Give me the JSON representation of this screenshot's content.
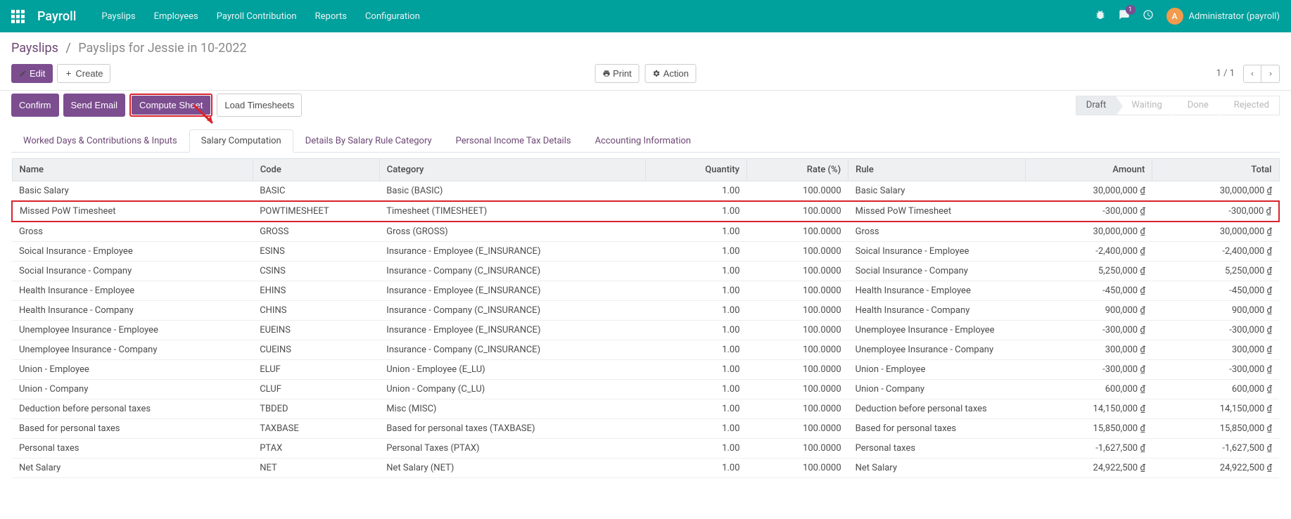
{
  "topbar": {
    "brand": "Payroll",
    "nav": [
      "Payslips",
      "Employees",
      "Payroll Contribution",
      "Reports",
      "Configuration"
    ],
    "chat_badge": "1",
    "user_initial": "A",
    "user_label": "Administrator (payroll)"
  },
  "breadcrumb": {
    "root": "Payslips",
    "current": "Payslips for Jessie in 10-2022"
  },
  "buttons": {
    "edit": "Edit",
    "create": "Create",
    "print": "Print",
    "action": "Action",
    "confirm": "Confirm",
    "send_email": "Send Email",
    "compute_sheet": "Compute Sheet",
    "load_timesheets": "Load Timesheets"
  },
  "pager": "1 / 1",
  "statuses": [
    "Draft",
    "Waiting",
    "Done",
    "Rejected"
  ],
  "tabs": [
    "Worked Days & Contributions & Inputs",
    "Salary Computation",
    "Details By Salary Rule Category",
    "Personal Income Tax Details",
    "Accounting Information"
  ],
  "table": {
    "headers": [
      "Name",
      "Code",
      "Category",
      "Quantity",
      "Rate (%)",
      "Rule",
      "Amount",
      "Total"
    ],
    "rows": [
      {
        "name": "Basic Salary",
        "code": "BASIC",
        "category": "Basic (BASIC)",
        "qty": "1.00",
        "rate": "100.0000",
        "rule": "Basic Salary",
        "amount": "30,000,000 ₫",
        "total": "30,000,000 ₫",
        "hl": false
      },
      {
        "name": "Missed PoW Timesheet",
        "code": "POWTIMESHEET",
        "category": "Timesheet (TIMESHEET)",
        "qty": "1.00",
        "rate": "100.0000",
        "rule": "Missed PoW Timesheet",
        "amount": "-300,000 ₫",
        "total": "-300,000 ₫",
        "hl": true
      },
      {
        "name": "Gross",
        "code": "GROSS",
        "category": "Gross (GROSS)",
        "qty": "1.00",
        "rate": "100.0000",
        "rule": "Gross",
        "amount": "30,000,000 ₫",
        "total": "30,000,000 ₫",
        "hl": false
      },
      {
        "name": "Soical Insurance - Employee",
        "code": "ESINS",
        "category": "Insurance - Employee (E_INSURANCE)",
        "qty": "1.00",
        "rate": "100.0000",
        "rule": "Soical Insurance - Employee",
        "amount": "-2,400,000 ₫",
        "total": "-2,400,000 ₫",
        "hl": false
      },
      {
        "name": "Social Insurance - Company",
        "code": "CSINS",
        "category": "Insurance - Company (C_INSURANCE)",
        "qty": "1.00",
        "rate": "100.0000",
        "rule": "Social Insurance - Company",
        "amount": "5,250,000 ₫",
        "total": "5,250,000 ₫",
        "hl": false
      },
      {
        "name": "Health Insurance - Employee",
        "code": "EHINS",
        "category": "Insurance - Employee (E_INSURANCE)",
        "qty": "1.00",
        "rate": "100.0000",
        "rule": "Health Insurance - Employee",
        "amount": "-450,000 ₫",
        "total": "-450,000 ₫",
        "hl": false
      },
      {
        "name": "Health Insurance - Company",
        "code": "CHINS",
        "category": "Insurance - Company (C_INSURANCE)",
        "qty": "1.00",
        "rate": "100.0000",
        "rule": "Health Insurance - Company",
        "amount": "900,000 ₫",
        "total": "900,000 ₫",
        "hl": false
      },
      {
        "name": "Unemployee Insurance - Employee",
        "code": "EUEINS",
        "category": "Insurance - Employee (E_INSURANCE)",
        "qty": "1.00",
        "rate": "100.0000",
        "rule": "Unemployee Insurance - Employee",
        "amount": "-300,000 ₫",
        "total": "-300,000 ₫",
        "hl": false
      },
      {
        "name": "Unemployee Insurance - Company",
        "code": "CUEINS",
        "category": "Insurance - Company (C_INSURANCE)",
        "qty": "1.00",
        "rate": "100.0000",
        "rule": "Unemployee Insurance - Company",
        "amount": "300,000 ₫",
        "total": "300,000 ₫",
        "hl": false
      },
      {
        "name": "Union - Employee",
        "code": "ELUF",
        "category": "Union - Employee (E_LU)",
        "qty": "1.00",
        "rate": "100.0000",
        "rule": "Union - Employee",
        "amount": "-300,000 ₫",
        "total": "-300,000 ₫",
        "hl": false
      },
      {
        "name": "Union - Company",
        "code": "CLUF",
        "category": "Union - Company (C_LU)",
        "qty": "1.00",
        "rate": "100.0000",
        "rule": "Union - Company",
        "amount": "600,000 ₫",
        "total": "600,000 ₫",
        "hl": false
      },
      {
        "name": "Deduction before personal taxes",
        "code": "TBDED",
        "category": "Misc (MISC)",
        "qty": "1.00",
        "rate": "100.0000",
        "rule": "Deduction before personal taxes",
        "amount": "14,150,000 ₫",
        "total": "14,150,000 ₫",
        "hl": false
      },
      {
        "name": "Based for personal taxes",
        "code": "TAXBASE",
        "category": "Based for personal taxes (TAXBASE)",
        "qty": "1.00",
        "rate": "100.0000",
        "rule": "Based for personal taxes",
        "amount": "15,850,000 ₫",
        "total": "15,850,000 ₫",
        "hl": false
      },
      {
        "name": "Personal taxes",
        "code": "PTAX",
        "category": "Personal Taxes (PTAX)",
        "qty": "1.00",
        "rate": "100.0000",
        "rule": "Personal taxes",
        "amount": "-1,627,500 ₫",
        "total": "-1,627,500 ₫",
        "hl": false
      },
      {
        "name": "Net Salary",
        "code": "NET",
        "category": "Net Salary (NET)",
        "qty": "1.00",
        "rate": "100.0000",
        "rule": "Net Salary",
        "amount": "24,922,500 ₫",
        "total": "24,922,500 ₫",
        "hl": false
      }
    ]
  }
}
